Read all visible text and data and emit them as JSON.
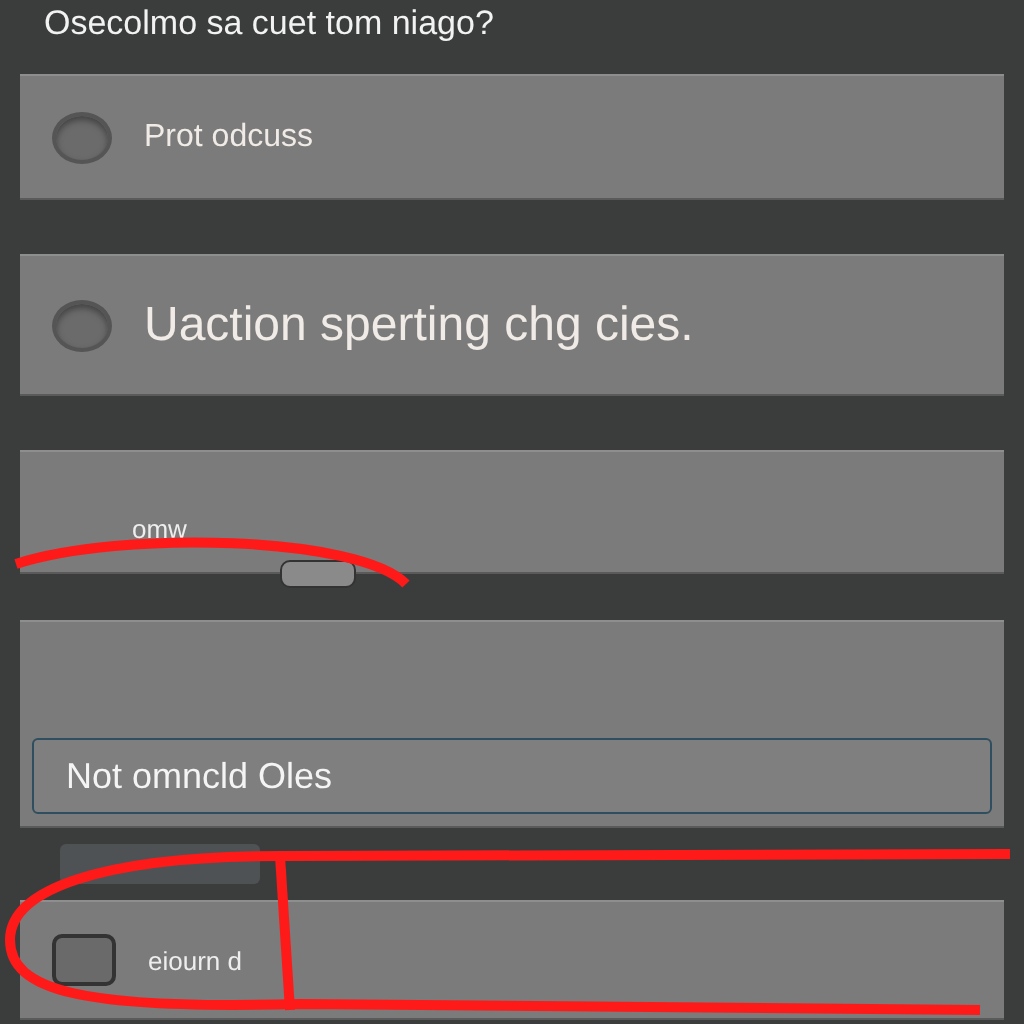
{
  "question": "Osecolmo sa cuet tom niago?",
  "options": [
    {
      "label": "Prot odcuss",
      "selected": false,
      "kind": "small"
    },
    {
      "label": "Uaction sperting chg cies.",
      "selected": false,
      "kind": "large"
    }
  ],
  "toggle_row": {
    "label": "omw"
  },
  "field": {
    "value": "Not omncld Oles"
  },
  "check_row": {
    "label": "eiourn d",
    "checked": false
  }
}
